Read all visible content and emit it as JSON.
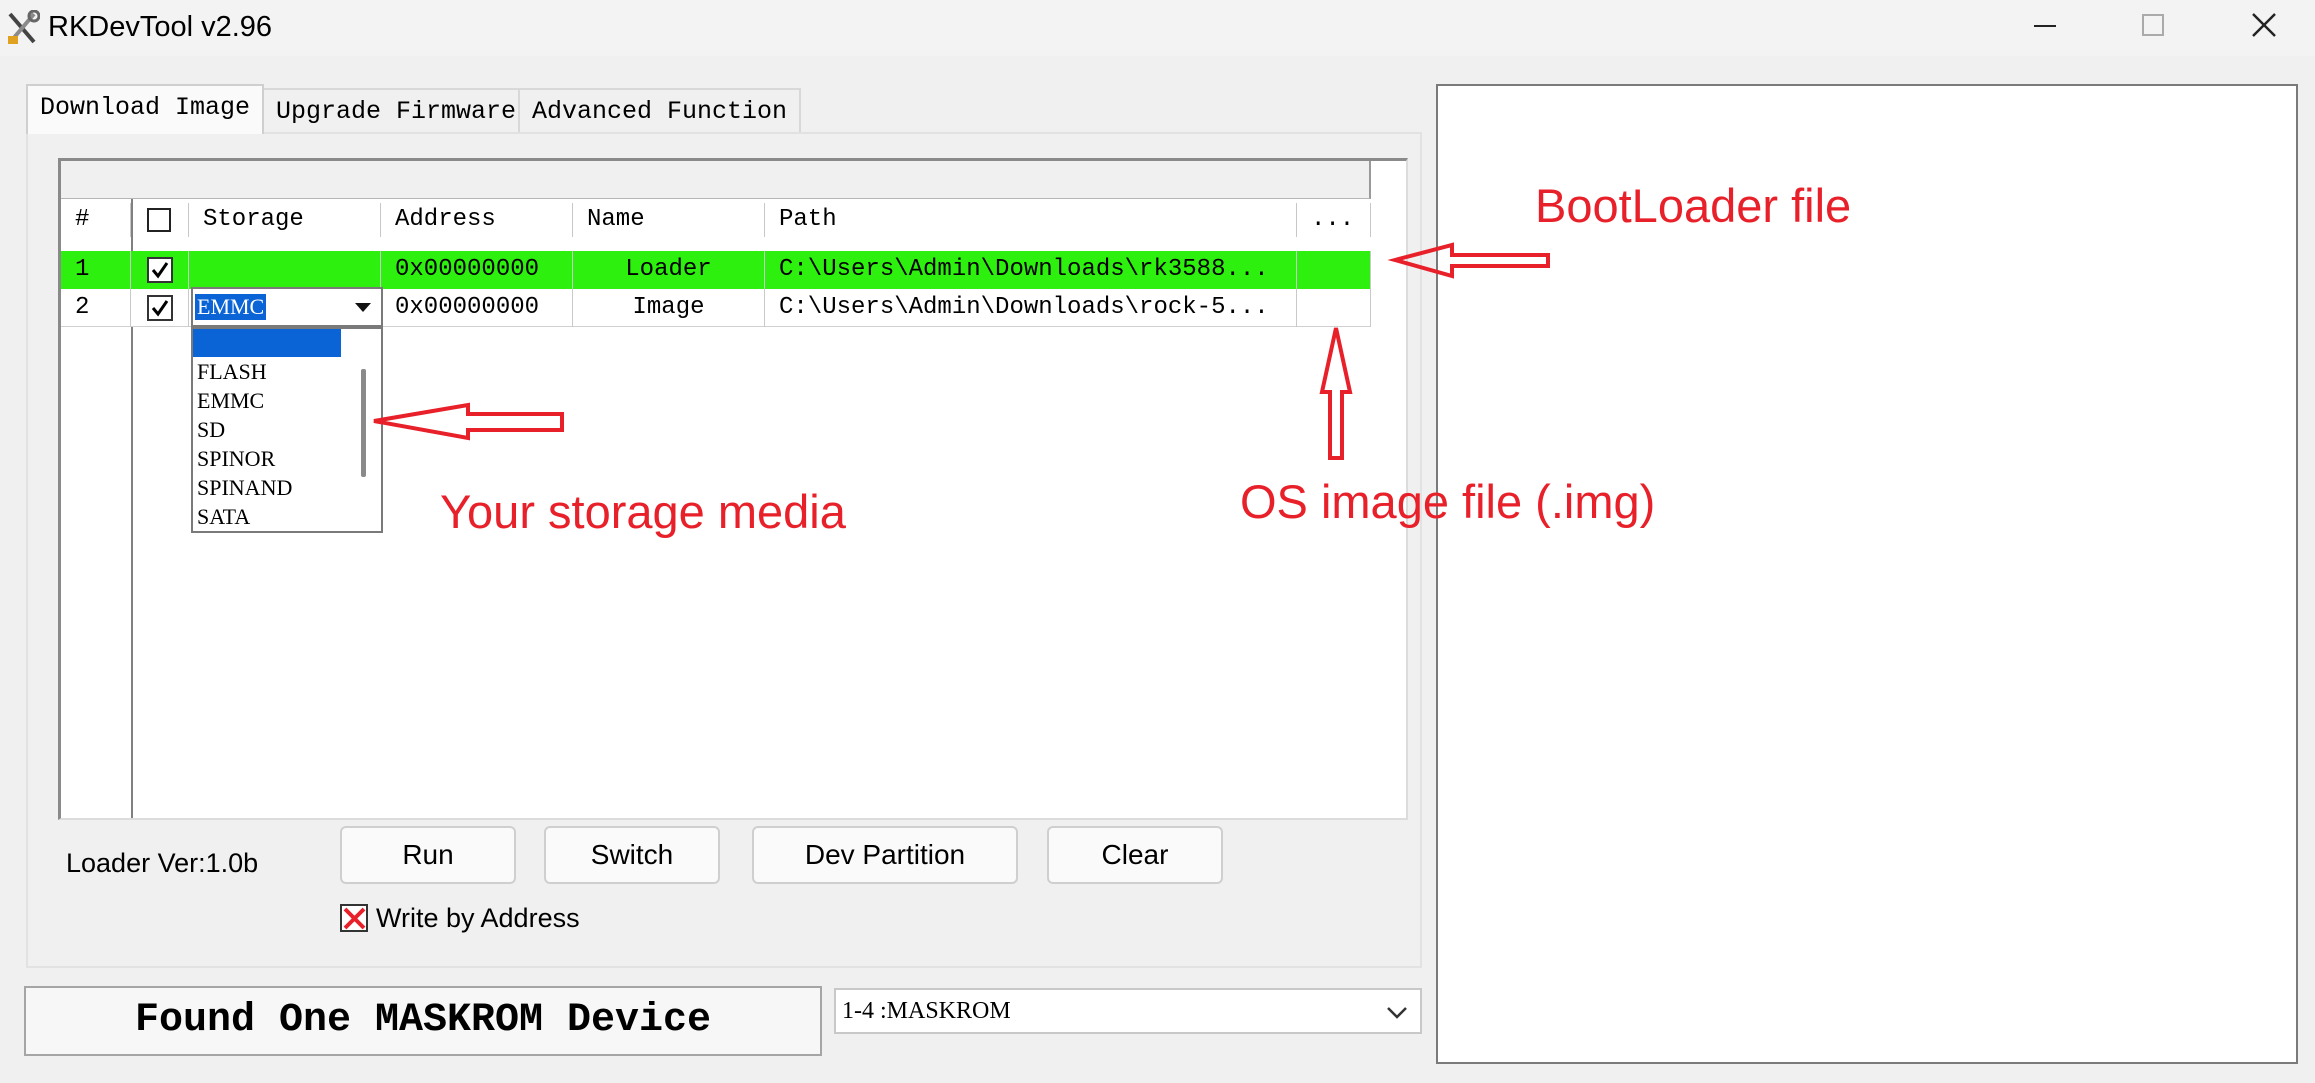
{
  "window": {
    "title": "RKDevTool v2.96",
    "controls": {
      "minimize": "minimize-icon",
      "maximize": "maximize-icon",
      "close": "close-icon"
    }
  },
  "tabs": [
    {
      "label": "Download Image",
      "active": true
    },
    {
      "label": "Upgrade Firmware",
      "active": false
    },
    {
      "label": "Advanced Function",
      "active": false
    }
  ],
  "table": {
    "headers": [
      "#",
      "",
      "Storage",
      "Address",
      "Name",
      "Path",
      "..."
    ],
    "rows": [
      {
        "num": "1",
        "checked": true,
        "storage": "",
        "address": "0x00000000",
        "name": "Loader",
        "path": "C:\\Users\\Admin\\Downloads\\rk3588...",
        "more": ""
      },
      {
        "num": "2",
        "checked": true,
        "storage": "EMMC",
        "address": "0x00000000",
        "name": "Image",
        "path": "C:\\Users\\Admin\\Downloads\\rock-5...",
        "more": ""
      }
    ],
    "row1_color": "#2ef00f"
  },
  "storage_dropdown": {
    "selected": "EMMC",
    "options": [
      "",
      "FLASH",
      "EMMC",
      "SD",
      "SPINOR",
      "SPINAND",
      "SATA"
    ]
  },
  "controls": {
    "loader_ver": "Loader Ver:1.0b",
    "run": "Run",
    "switch": "Switch",
    "dev_partition": "Dev Partition",
    "clear": "Clear",
    "write_by_address": "Write by Address",
    "write_by_address_checked": true
  },
  "status": {
    "message": "Found One MASKROM Device",
    "device": "1-4 :MASKROM"
  },
  "annotations": {
    "bootloader": "BootLoader file",
    "storage": "Your storage media",
    "os_image": "OS image file  (.img)",
    "color": "#e8202a"
  }
}
